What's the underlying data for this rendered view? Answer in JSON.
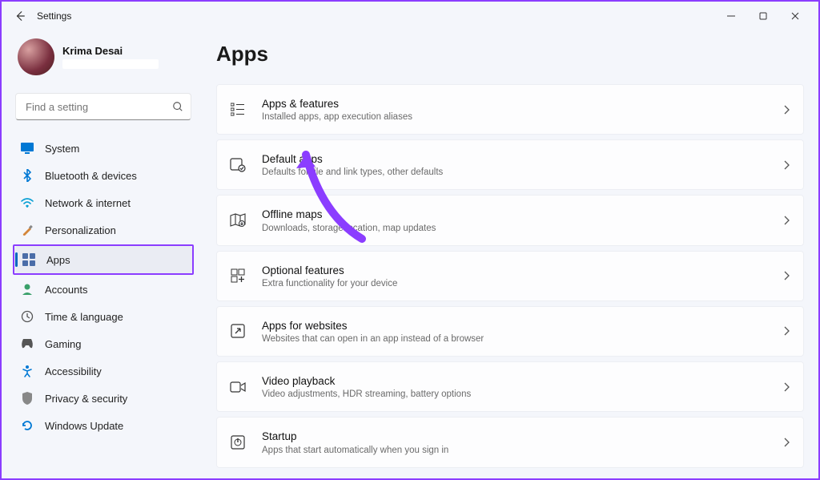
{
  "window": {
    "title": "Settings"
  },
  "user": {
    "name": "Krima Desai"
  },
  "search": {
    "placeholder": "Find a setting"
  },
  "nav": {
    "items": [
      {
        "label": "System",
        "icon": "system-icon"
      },
      {
        "label": "Bluetooth & devices",
        "icon": "bluetooth-icon"
      },
      {
        "label": "Network & internet",
        "icon": "wifi-icon"
      },
      {
        "label": "Personalization",
        "icon": "brush-icon"
      },
      {
        "label": "Apps",
        "icon": "apps-icon"
      },
      {
        "label": "Accounts",
        "icon": "account-icon"
      },
      {
        "label": "Time & language",
        "icon": "time-icon"
      },
      {
        "label": "Gaming",
        "icon": "gaming-icon"
      },
      {
        "label": "Accessibility",
        "icon": "accessibility-icon"
      },
      {
        "label": "Privacy & security",
        "icon": "shield-icon"
      },
      {
        "label": "Windows Update",
        "icon": "update-icon"
      }
    ],
    "activeIndex": 4
  },
  "page": {
    "title": "Apps"
  },
  "cards": [
    {
      "title": "Apps & features",
      "subtitle": "Installed apps, app execution aliases"
    },
    {
      "title": "Default apps",
      "subtitle": "Defaults for file and link types, other defaults"
    },
    {
      "title": "Offline maps",
      "subtitle": "Downloads, storage location, map updates"
    },
    {
      "title": "Optional features",
      "subtitle": "Extra functionality for your device"
    },
    {
      "title": "Apps for websites",
      "subtitle": "Websites that can open in an app instead of a browser"
    },
    {
      "title": "Video playback",
      "subtitle": "Video adjustments, HDR streaming, battery options"
    },
    {
      "title": "Startup",
      "subtitle": "Apps that start automatically when you sign in"
    }
  ]
}
